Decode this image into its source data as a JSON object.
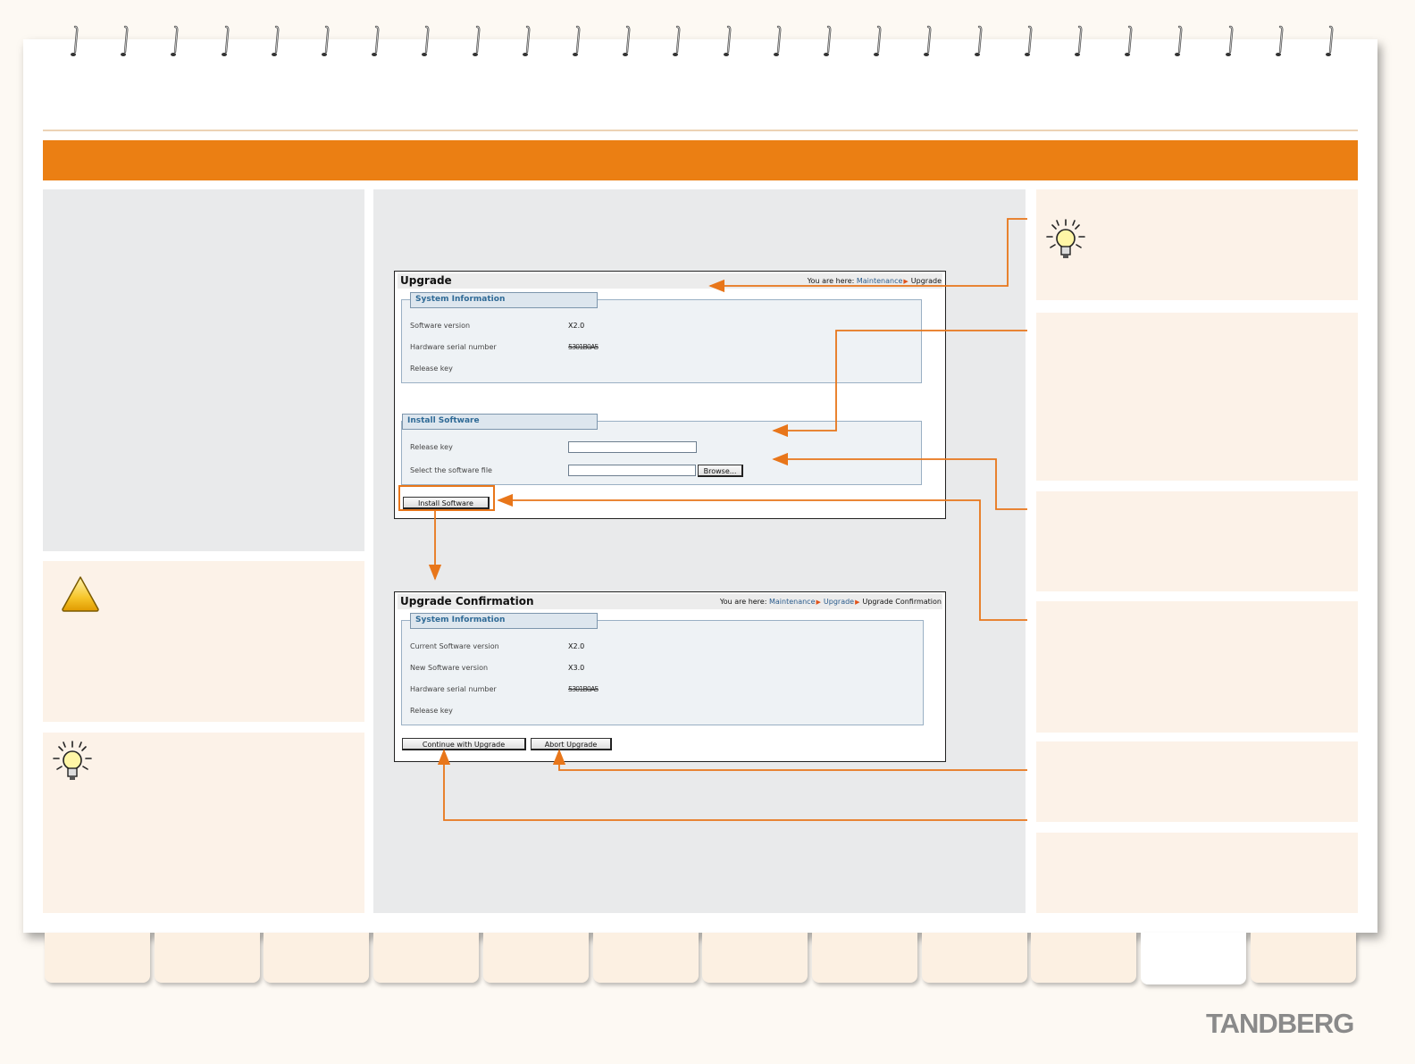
{
  "upgrade_page": {
    "title": "Upgrade",
    "breadcrumb": {
      "prefix": "You are here:",
      "items": [
        "Maintenance",
        "Upgrade"
      ]
    },
    "system_information": {
      "legend": "System Information",
      "rows": [
        {
          "label": "Software version",
          "value": "X2.0"
        },
        {
          "label": "Hardware serial number",
          "value": "5301B0A5"
        },
        {
          "label": "Release key",
          "value": ""
        }
      ]
    },
    "install_software": {
      "legend": "Install Software",
      "release_key_label": "Release key",
      "release_key_value": "",
      "file_label": "Select the software file",
      "file_value": "",
      "browse_label": "Browse..."
    },
    "install_button_label": "Install Software"
  },
  "confirmation_page": {
    "title": "Upgrade Confirmation",
    "breadcrumb": {
      "prefix": "You are here:",
      "items": [
        "Maintenance",
        "Upgrade",
        "Upgrade Confirmation"
      ]
    },
    "system_information": {
      "legend": "System Information",
      "rows": [
        {
          "label": "Current Software version",
          "value": "X2.0"
        },
        {
          "label": "New Software version",
          "value": "X3.0"
        },
        {
          "label": "Hardware serial number",
          "value": "5301B0A5"
        },
        {
          "label": "Release key",
          "value": ""
        }
      ]
    },
    "continue_button_label": "Continue with Upgrade",
    "abort_button_label": "Abort Upgrade"
  },
  "brand": {
    "logo_text": "TANDBERG"
  },
  "colors": {
    "accent": "#eb7f13",
    "panel_grey": "#e9eaeb",
    "panel_cream": "#fcf2e8",
    "callout_line": "#e8761a"
  },
  "icons": {
    "warning": "warning-triangle-icon",
    "tip": "lightbulb-icon"
  },
  "tabs": {
    "count": 12,
    "active_index": 10
  }
}
